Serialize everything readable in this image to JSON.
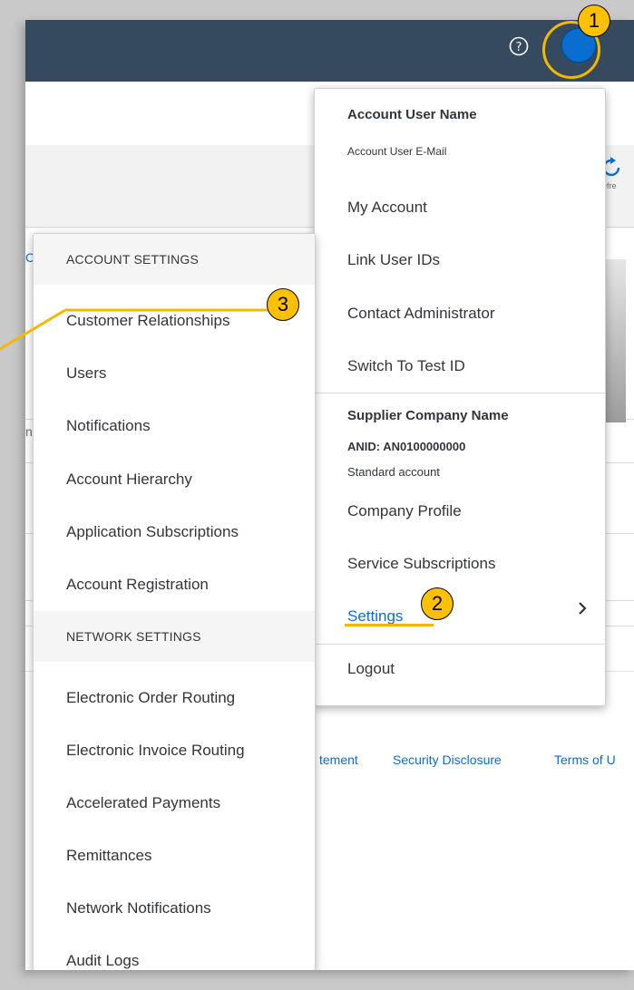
{
  "header": {
    "help_icon": "help-circle-icon",
    "avatar_icon": "user-avatar-icon"
  },
  "background": {
    "refresh_label": "efre",
    "footer_links": [
      "tement",
      "Security Disclosure",
      "Terms of U"
    ],
    "side_letters": [
      "C",
      "n"
    ]
  },
  "user_menu": {
    "user_name": "Account User Name",
    "user_email": "Account User E-Mail",
    "items": [
      "My Account",
      "Link User IDs",
      "Contact Administrator",
      "Switch To Test ID"
    ],
    "company_name": "Supplier Company Name",
    "anid": "ANID: AN0100000000",
    "account_type": "Standard account",
    "company_items": [
      "Company Profile",
      "Service Subscriptions"
    ],
    "settings_label": "Settings",
    "logout_label": "Logout"
  },
  "settings_menu": {
    "account_section": "ACCOUNT SETTINGS",
    "account_items": [
      "Customer Relationships",
      "Users",
      "Notifications",
      "Account Hierarchy",
      "Application Subscriptions",
      "Account Registration"
    ],
    "network_section": "NETWORK SETTINGS",
    "network_items": [
      "Electronic Order Routing",
      "Electronic Invoice Routing",
      "Accelerated Payments",
      "Remittances",
      "Network Notifications",
      "Audit Logs"
    ]
  },
  "callouts": {
    "step1": "1",
    "step2": "2",
    "step3": "3"
  },
  "colors": {
    "shellbar": "#354a5f",
    "link": "#0a6ed1",
    "callout": "#ffc000",
    "highlight_line": "#f5b800"
  }
}
